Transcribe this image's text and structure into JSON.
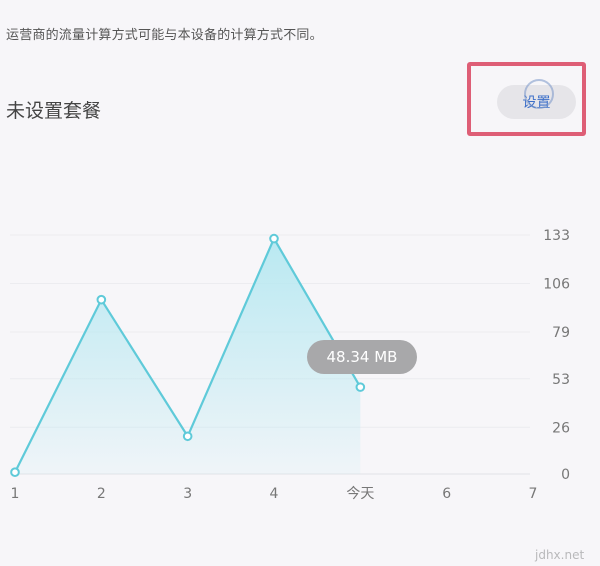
{
  "notice": "运营商的流量计算方式可能与本设备的计算方式不同。",
  "plan": {
    "label": "未设置套餐",
    "set_button": "设置"
  },
  "chart_data": {
    "type": "area",
    "x": [
      "1",
      "2",
      "3",
      "4",
      "今天",
      "6",
      "7"
    ],
    "values": [
      1,
      97,
      21,
      131,
      48.34
    ],
    "y_ticks": [
      "0",
      "26",
      "53",
      "79",
      "106",
      "133"
    ],
    "ylim": [
      0,
      133
    ],
    "axis_position": "right",
    "grid": true,
    "line_color": "#5fcad9",
    "fill_color": "#b6e8f1",
    "tooltip": "48.34 MB"
  },
  "watermark": "jdhx.net"
}
